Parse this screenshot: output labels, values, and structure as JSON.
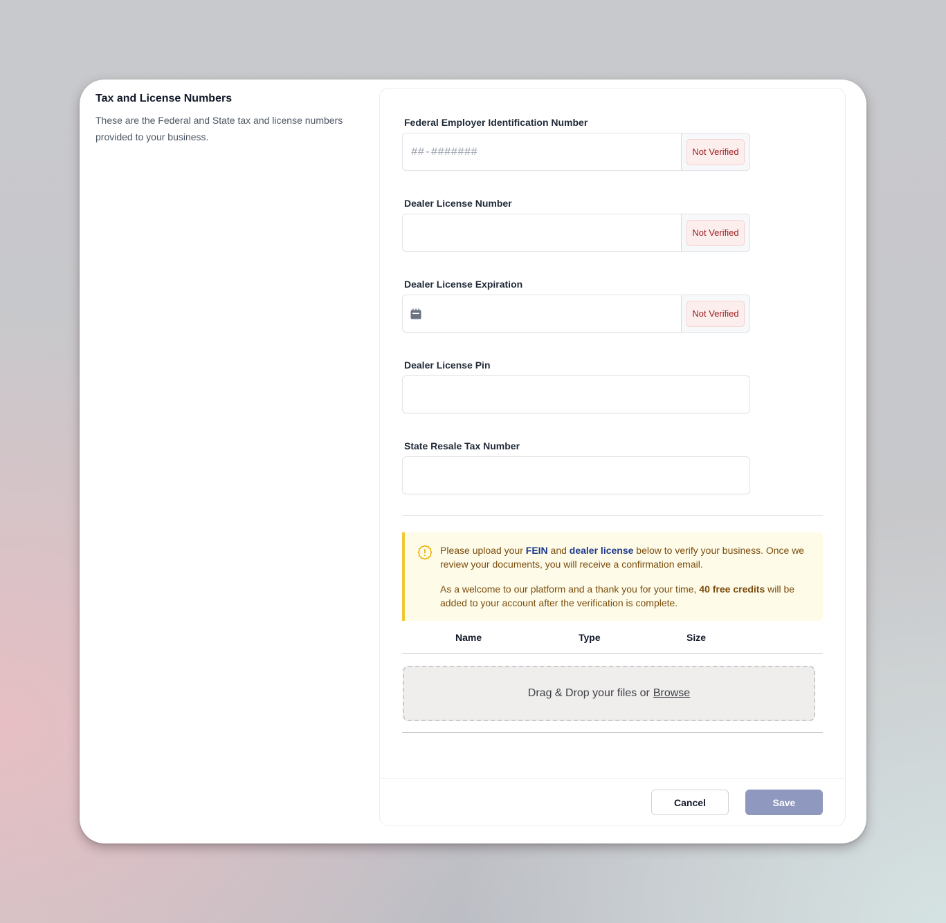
{
  "section": {
    "title": "Tax and License Numbers",
    "description": "These are the Federal and State tax and license numbers provided to your business."
  },
  "fields": [
    {
      "label": "Federal Employer Identification Number",
      "value": "",
      "placeholder": "##-#######",
      "status": "Not Verified"
    },
    {
      "label": "Dealer License Number",
      "value": "",
      "placeholder": "",
      "status": "Not Verified"
    },
    {
      "label": "Dealer License Expiration",
      "value": "",
      "placeholder": "",
      "status": "Not Verified",
      "icon": "calendar-icon"
    },
    {
      "label": "Dealer License Pin",
      "value": "",
      "placeholder": ""
    },
    {
      "label": "State Resale Tax Number",
      "value": "",
      "placeholder": ""
    }
  ],
  "alert": {
    "icon": "warning-icon",
    "p1_before": "Please upload your ",
    "p1_link1": "FEIN",
    "p1_mid": " and ",
    "p1_link2": "dealer license",
    "p1_after": " below to verify your business. Once we review your documents, you will receive a confirmation email.",
    "p2_before": "As a welcome to our platform and a thank you for your time, ",
    "p2_strong": "40 free credits",
    "p2_after": " will be added to your account after the verification is complete."
  },
  "files_table": {
    "columns": [
      "Name",
      "Type",
      "Size"
    ],
    "rows": []
  },
  "dropzone": {
    "text": "Drag & Drop your files or",
    "browse_label": "Browse"
  },
  "actions": {
    "cancel_label": "Cancel",
    "save_label": "Save"
  },
  "colors": {
    "status_bg": "#fdeeee",
    "status_text": "#9b1c1c",
    "alert_bg": "#fefce8",
    "alert_border": "#f0c836",
    "link": "#1e3a8a",
    "save_button": "#8f99bf"
  }
}
